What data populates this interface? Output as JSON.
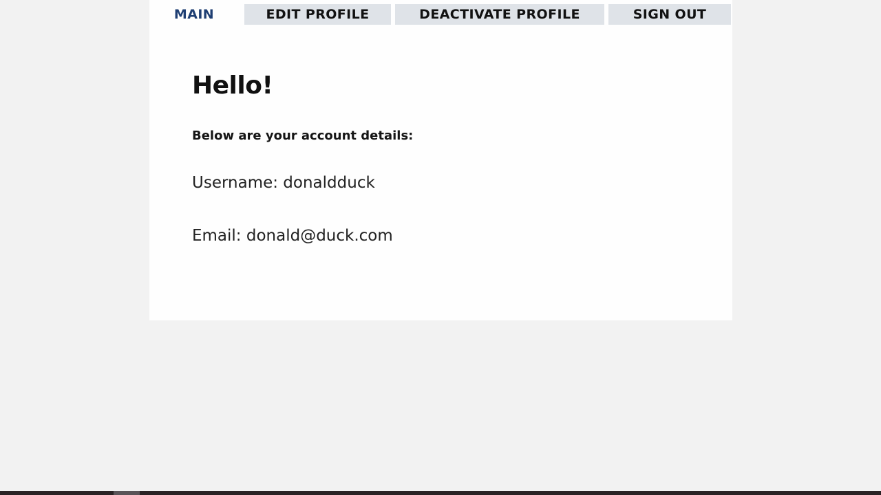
{
  "tabs": [
    {
      "label": "MAIN",
      "active": true
    },
    {
      "label": "EDIT PROFILE",
      "active": false
    },
    {
      "label": "DEACTIVATE PROFILE",
      "active": false
    },
    {
      "label": "SIGN OUT",
      "active": false
    }
  ],
  "main": {
    "greeting": "Hello!",
    "subtitle": "Below are your account details:",
    "username_line": "Username: donaldduck",
    "email_line": "Email: donald@duck.com"
  },
  "colors": {
    "active_tab": "#1f3f73",
    "inactive_tab_bg": "#dfe3e8",
    "page_bg": "#f2f2f2",
    "card_bg": "#fefefe"
  }
}
